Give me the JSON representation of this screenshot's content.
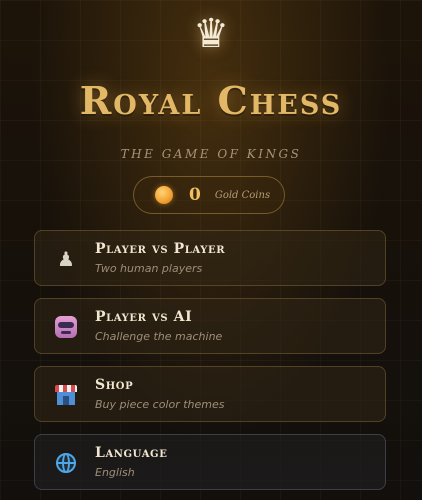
{
  "header": {
    "crown_icon": "crown-icon",
    "title": "Royal Chess",
    "subtitle": "THE GAME OF KINGS"
  },
  "coins": {
    "icon": "gold-coin-icon",
    "value": "0",
    "label": "Gold Coins"
  },
  "menu": [
    {
      "icon": "pawn-icon",
      "title": "Player vs Player",
      "subtitle": "Two human players"
    },
    {
      "icon": "robot-icon",
      "title": "Player vs AI",
      "subtitle": "Challenge the machine"
    },
    {
      "icon": "shop-icon",
      "title": "Shop",
      "subtitle": "Buy piece color themes"
    },
    {
      "icon": "globe-icon",
      "title": "Language",
      "subtitle": "English"
    }
  ],
  "colors": {
    "title_gold": "#e2b867",
    "coin_gold": "#f0c060",
    "background": "#17110a"
  }
}
